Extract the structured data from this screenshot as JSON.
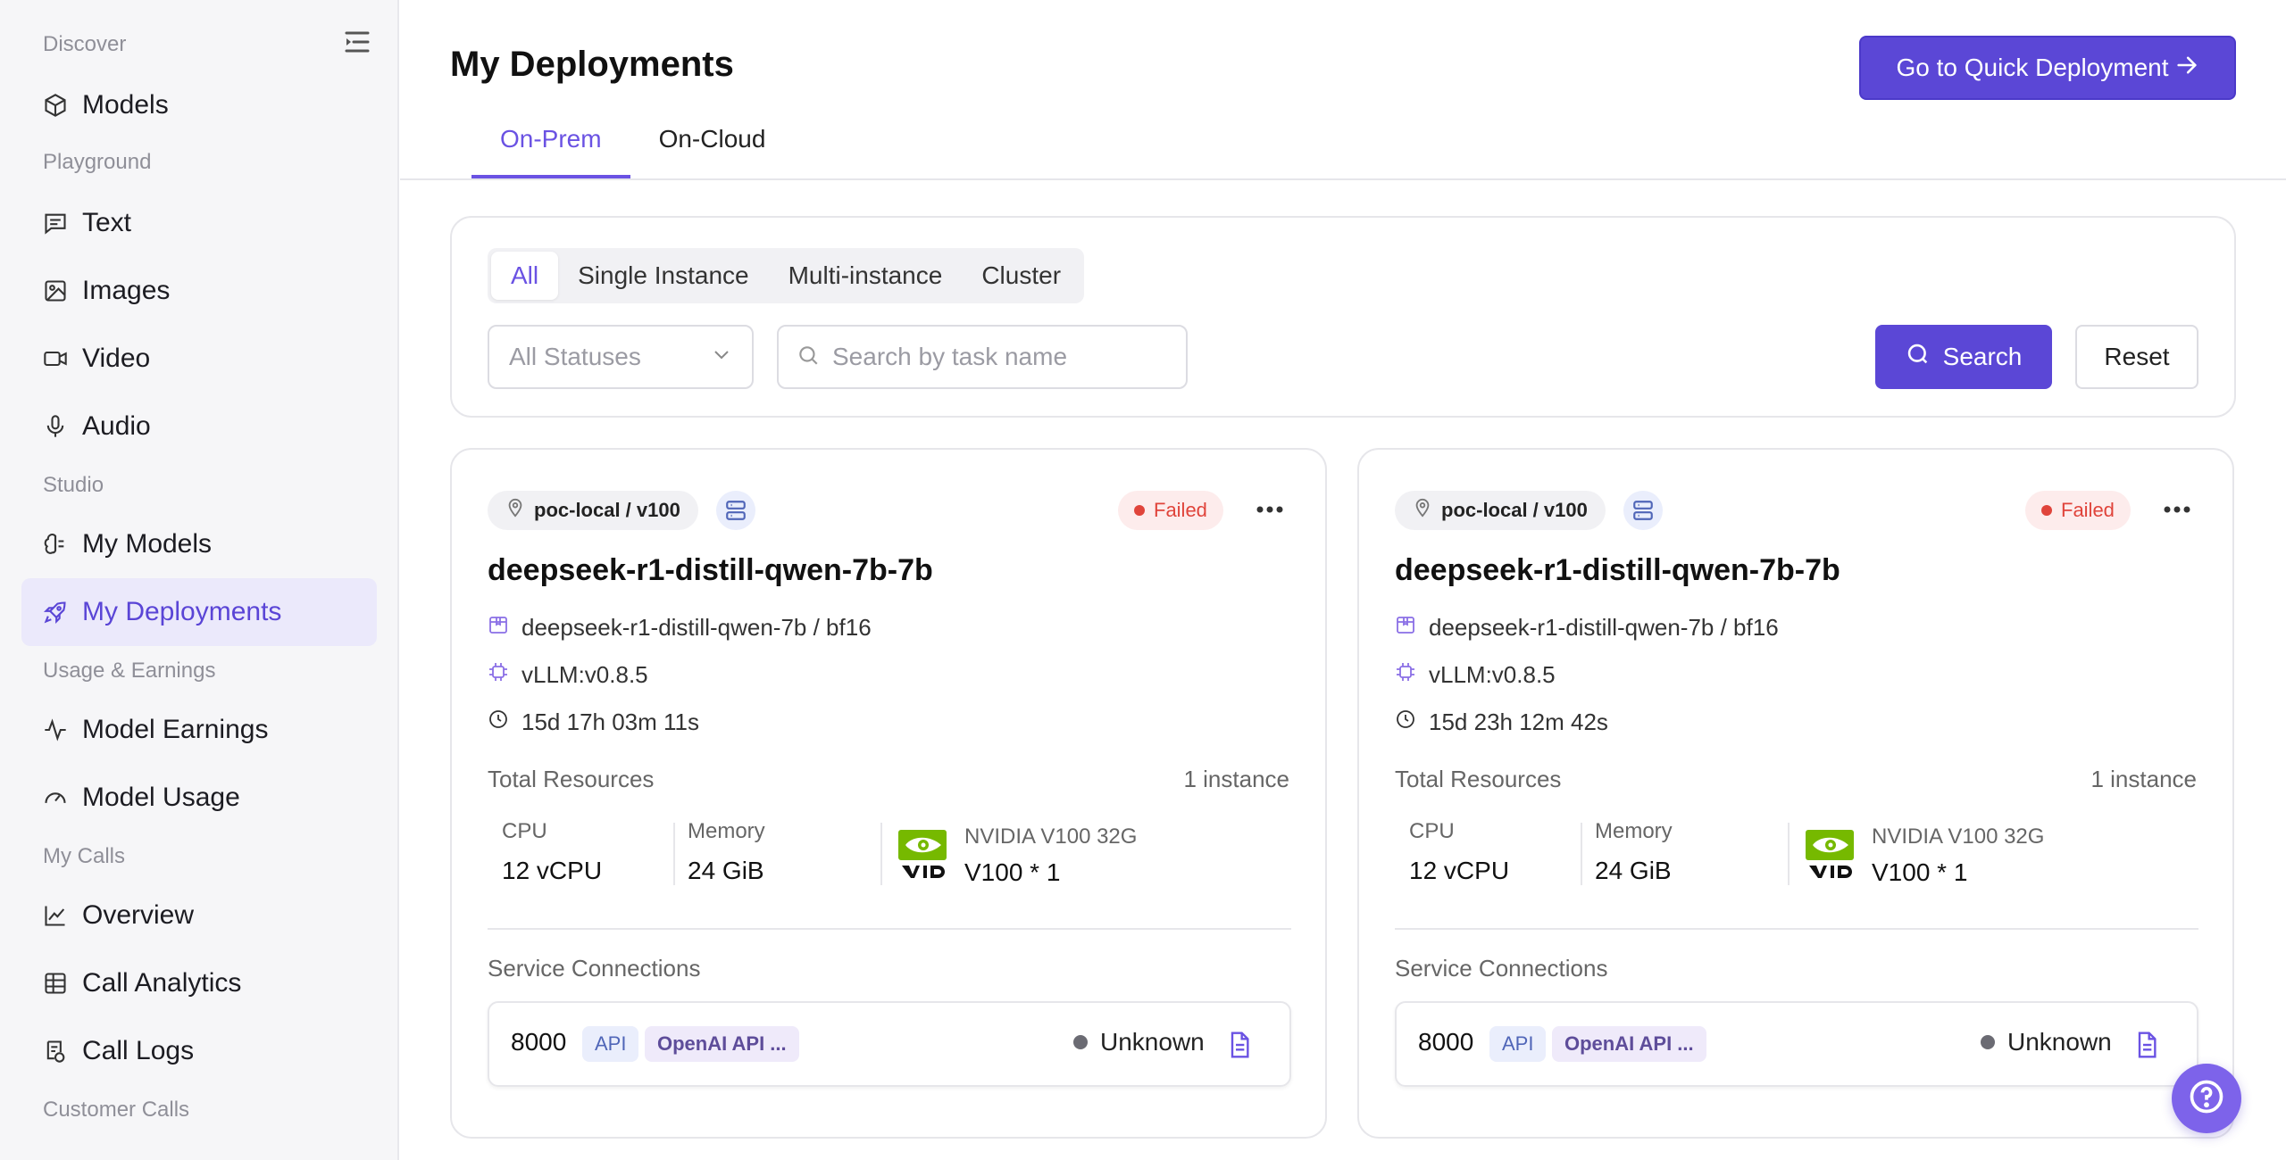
{
  "sidebar": {
    "sections": {
      "discover": "Discover",
      "playground": "Playground",
      "studio": "Studio",
      "usage": "Usage & Earnings",
      "calls": "My Calls",
      "customer": "Customer Calls"
    },
    "items": {
      "models": "Models",
      "text": "Text",
      "images": "Images",
      "video": "Video",
      "audio": "Audio",
      "my_models": "My Models",
      "my_deployments": "My Deployments",
      "model_earnings": "Model Earnings",
      "model_usage": "Model Usage",
      "overview": "Overview",
      "call_analytics": "Call Analytics",
      "call_logs": "Call Logs"
    }
  },
  "header": {
    "title": "My Deployments",
    "quick_button": "Go to Quick Deployment",
    "tabs": [
      "On-Prem",
      "On-Cloud"
    ]
  },
  "filters": {
    "segments": [
      "All",
      "Single Instance",
      "Multi-instance",
      "Cluster"
    ],
    "status_select": "All Statuses",
    "search_placeholder": "Search by task name",
    "search_button": "Search",
    "reset_button": "Reset"
  },
  "cards": [
    {
      "location": "poc-local / v100",
      "status": "Failed",
      "title": "deepseek-r1-distill-qwen-7b-7b",
      "model": "deepseek-r1-distill-qwen-7b / bf16",
      "engine": "vLLM:v0.8.5",
      "uptime": "15d 17h 03m 11s",
      "total_resources_label": "Total Resources",
      "instances": "1 instance",
      "cpu_label": "CPU",
      "cpu_value": "12  vCPU",
      "memory_label": "Memory",
      "memory_value": "24  GiB",
      "gpu_name": "NVIDIA V100 32G",
      "gpu_value": "V100  *  1",
      "service_label": "Service Connections",
      "port": "8000",
      "tag_api": "API",
      "tag_openai": "OpenAI API ...",
      "conn_status": "Unknown"
    },
    {
      "location": "poc-local / v100",
      "status": "Failed",
      "title": "deepseek-r1-distill-qwen-7b-7b",
      "model": "deepseek-r1-distill-qwen-7b / bf16",
      "engine": "vLLM:v0.8.5",
      "uptime": "15d 23h 12m 42s",
      "total_resources_label": "Total Resources",
      "instances": "1 instance",
      "cpu_label": "CPU",
      "cpu_value": "12  vCPU",
      "memory_label": "Memory",
      "memory_value": "24  GiB",
      "gpu_name": "NVIDIA V100 32G",
      "gpu_value": "V100  *  1",
      "service_label": "Service Connections",
      "port": "8000",
      "tag_api": "API",
      "tag_openai": "OpenAI API ...",
      "conn_status": "Unknown"
    }
  ],
  "colors": {
    "accent": "#5b47d6",
    "failed": "#e0443b",
    "nvidia": "#76b900"
  }
}
